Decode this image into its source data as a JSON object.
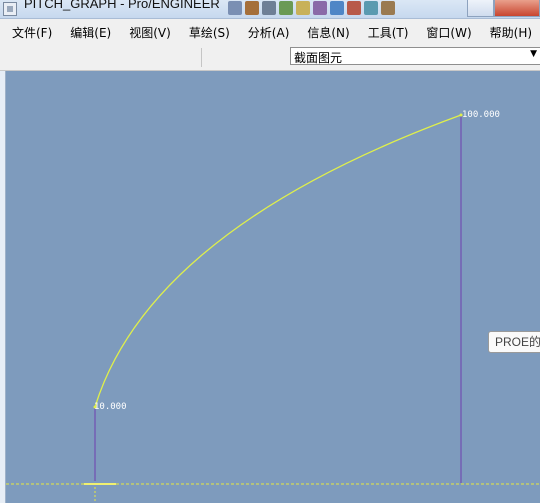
{
  "window": {
    "title": "PITCH_GRAPH - Pro/ENGINEER"
  },
  "menubar": {
    "items": [
      "文件(F)",
      "编辑(E)",
      "视图(V)",
      "草绘(S)",
      "分析(A)",
      "信息(N)",
      "工具(T)",
      "窗口(W)",
      "帮助(H)"
    ]
  },
  "toolbar": {
    "filter_value": "截面图元"
  },
  "graph": {
    "start_label": "10.000",
    "end_label": "100.000",
    "curve_color": "#e0f04a",
    "vertical_line_color": "#6f3fb0",
    "axis_color": "#e8e840",
    "background_color": "#7e9bbd"
  },
  "tooltip": {
    "text": "PROE的"
  }
}
